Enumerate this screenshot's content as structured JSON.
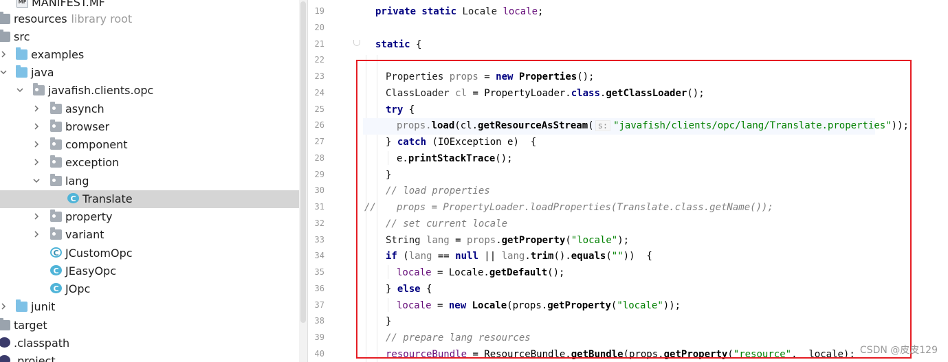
{
  "project_tree": {
    "items": [
      {
        "label": "MANIFEST.MF",
        "icon": "manifest-file-icon",
        "indent": 1
      },
      {
        "label": "resources",
        "hint": "library root",
        "icon": "resources-folder-icon",
        "indent": 0
      },
      {
        "label": "src",
        "icon": "folder-icon",
        "indent": 0
      },
      {
        "label": "examples",
        "icon": "source-folder-icon",
        "indent": 1
      },
      {
        "label": "java",
        "icon": "source-folder-icon",
        "indent": 1
      },
      {
        "label": "javafish.clients.opc",
        "icon": "package-icon",
        "indent": 2
      },
      {
        "label": "asynch",
        "icon": "package-icon",
        "indent": 3
      },
      {
        "label": "browser",
        "icon": "package-icon",
        "indent": 3
      },
      {
        "label": "component",
        "icon": "package-icon",
        "indent": 3
      },
      {
        "label": "exception",
        "icon": "package-icon",
        "indent": 3
      },
      {
        "label": "lang",
        "icon": "package-icon",
        "indent": 3
      },
      {
        "label": "Translate",
        "icon": "class-icon",
        "indent": 4,
        "selected": true
      },
      {
        "label": "property",
        "icon": "package-icon",
        "indent": 3
      },
      {
        "label": "variant",
        "icon": "package-icon",
        "indent": 3
      },
      {
        "label": "JCustomOpc",
        "icon": "class-icon",
        "indent": 3
      },
      {
        "label": "JEasyOpc",
        "icon": "class-icon",
        "indent": 3
      },
      {
        "label": "JOpc",
        "icon": "class-icon",
        "indent": 3
      },
      {
        "label": "junit",
        "icon": "source-folder-icon",
        "indent": 1
      },
      {
        "label": "target",
        "icon": "folder-icon",
        "indent": 0
      },
      {
        "label": ".classpath",
        "icon": "eclipse-file-icon",
        "indent": 0
      },
      {
        "label": ".project",
        "icon": "eclipse-file-icon",
        "indent": 0
      }
    ]
  },
  "editor": {
    "line_numbers": [
      "19",
      "20",
      "21",
      "22",
      "23",
      "24",
      "25",
      "26",
      "27",
      "28",
      "29",
      "30",
      "31",
      "32",
      "33",
      "34",
      "35",
      "36",
      "37",
      "38",
      "39",
      "40"
    ],
    "line_comment_marker": "//",
    "inlay_hint": "s:",
    "code": {
      "l19": {
        "kw": "private static ",
        "type": "Locale ",
        "fld": "locale",
        "end": ";"
      },
      "l21": {
        "kw": "static",
        "end": " {"
      },
      "l23": {
        "a": "Properties ",
        "b": "props",
        "c": " = ",
        "kw": "new ",
        "d": "Properties",
        "e": "();"
      },
      "l24": {
        "a": "ClassLoader ",
        "b": "cl",
        "c": " = PropertyLoader.",
        "kw": "class",
        "d": ".",
        "m": "getClassLoader",
        "e": "();"
      },
      "l25": {
        "kw": "try",
        "e": " {"
      },
      "l26": {
        "a": "props.",
        "m1": "load",
        "b": "(cl.",
        "m2": "getResourceAsStream",
        "c": "(",
        "str": "\"javafish/clients/opc/lang/Translate.properties\"",
        "e": "));"
      },
      "l27": {
        "a": "} ",
        "kw": "catch",
        "b": " (IOException e)  {"
      },
      "l28": {
        "a": "e.",
        "m": "printStackTrace",
        "e": "();"
      },
      "l29": {
        "a": "}"
      },
      "l30": {
        "cmt": "// load properties"
      },
      "l31": {
        "cmt": "props = PropertyLoader.loadProperties(Translate.class.getName());"
      },
      "l32": {
        "cmt": "// set current locale"
      },
      "l33": {
        "a": "String ",
        "b": "lang",
        "c": " = ",
        "d": "props",
        "e": ".",
        "m": "getProperty",
        "f": "(",
        "str": "\"locale\"",
        "g": ");"
      },
      "l34": {
        "kw": "if",
        "a": " (",
        "b": "lang",
        "c": " == ",
        "kw2": "null",
        "d": " || ",
        "e": "lang",
        "f": ".",
        "m1": "trim",
        "g": "().",
        "m2": "equals",
        "h": "(",
        "str": "\"\"",
        "i": "))  {"
      },
      "l35": {
        "a": "locale",
        "b": " = Locale.",
        "m": "getDefault",
        "e": "();"
      },
      "l36": {
        "a": "} ",
        "kw": "else",
        "e": " {"
      },
      "l37": {
        "a": "locale",
        "b": " = ",
        "kw": "new ",
        "c": "Locale",
        "d": "(props.",
        "m": "getProperty",
        "e": "(",
        "str": "\"locale\"",
        "f": "));"
      },
      "l38": {
        "a": "}"
      },
      "l39": {
        "cmt": "// prepare lang resources"
      },
      "l40": {
        "a": "resourceBundle",
        "b": " = ResourceBundle.",
        "m1": "getBundle",
        "c": "(props.",
        "m2": "getProperty",
        "d": "(",
        "str": "\"resource\"",
        "e": ",  locale);"
      }
    }
  },
  "watermark": "CSDN @皮皮129",
  "colors": {
    "highlight_box": "#e51c23",
    "keyword": "#000080",
    "string": "#008000",
    "comment": "#808080",
    "selected_row": "#d5d5d5"
  }
}
